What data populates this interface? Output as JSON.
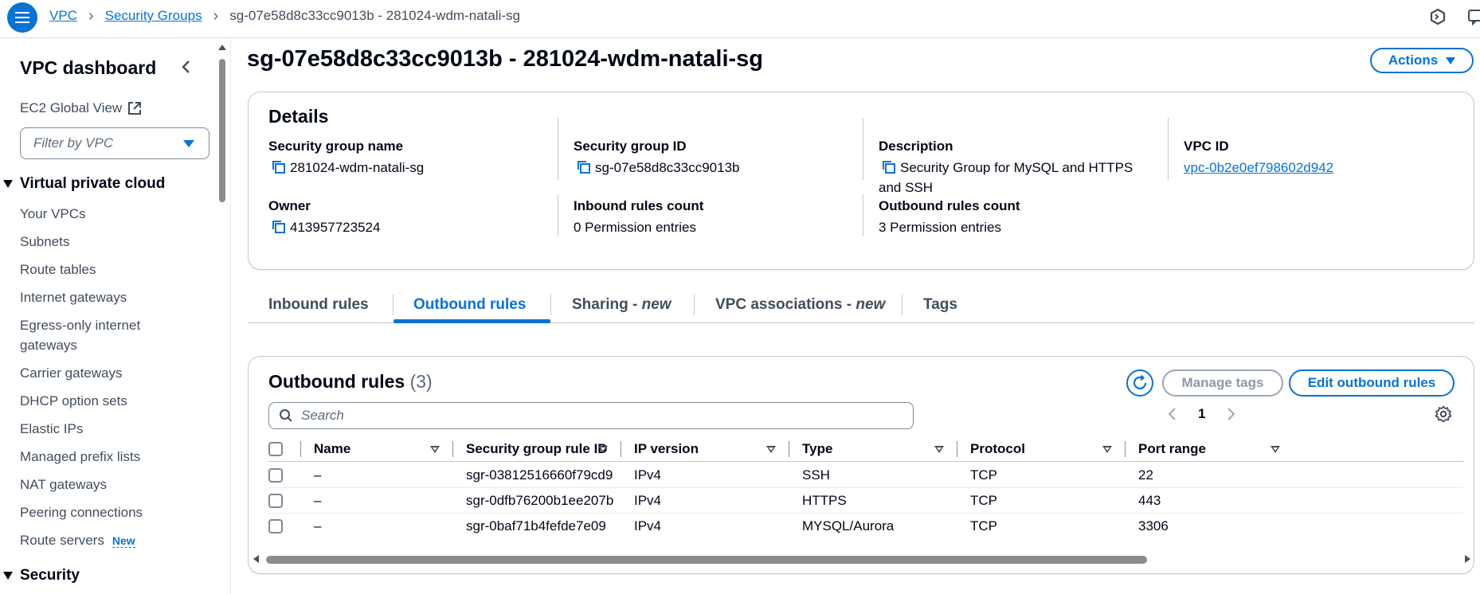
{
  "breadcrumb": {
    "items": [
      "VPC",
      "Security Groups"
    ],
    "current": "sg-07e58d8c33cc9013b - 281024-wdm-natali-sg"
  },
  "sidebar": {
    "title": "VPC dashboard",
    "global_view": "EC2 Global View",
    "filter_placeholder": "Filter by VPC",
    "section_vpc": "Virtual private cloud",
    "items": [
      "Your VPCs",
      "Subnets",
      "Route tables",
      "Internet gateways",
      "Egress-only internet gateways",
      "Carrier gateways",
      "DHCP option sets",
      "Elastic IPs",
      "Managed prefix lists",
      "NAT gateways",
      "Peering connections",
      "Route servers"
    ],
    "route_servers_badge": "New",
    "section_security": "Security"
  },
  "page": {
    "title": "sg-07e58d8c33cc9013b - 281024-wdm-natali-sg",
    "actions_label": "Actions"
  },
  "details": {
    "heading": "Details",
    "sg_name_label": "Security group name",
    "sg_name_value": "281024-wdm-natali-sg",
    "sg_id_label": "Security group ID",
    "sg_id_value": "sg-07e58d8c33cc9013b",
    "description_label": "Description",
    "description_value": "Security Group for MySQL and HTTPS and SSH",
    "vpc_id_label": "VPC ID",
    "vpc_id_value": "vpc-0b2e0ef798602d942",
    "owner_label": "Owner",
    "owner_value": "413957723524",
    "inbound_count_label": "Inbound rules count",
    "inbound_count_value": "0 Permission entries",
    "outbound_count_label": "Outbound rules count",
    "outbound_count_value": "3 Permission entries"
  },
  "tabs": {
    "inbound": "Inbound rules",
    "outbound": "Outbound rules",
    "sharing": "Sharing - ",
    "sharing_new": "new",
    "vpc_assoc": "VPC associations - ",
    "vpc_assoc_new": "new",
    "tags": "Tags"
  },
  "rules": {
    "heading": "Outbound rules",
    "count": "(3)",
    "manage_tags_label": "Manage tags",
    "edit_label": "Edit outbound rules",
    "search_placeholder": "Search",
    "page_number": "1",
    "columns": {
      "name": "Name",
      "rule_id": "Security group rule ID",
      "ip_version": "IP version",
      "type": "Type",
      "protocol": "Protocol",
      "port_range": "Port range"
    },
    "rows": [
      {
        "name": "–",
        "rule_id": "sgr-03812516660f79cd9",
        "ip_version": "IPv4",
        "type": "SSH",
        "protocol": "TCP",
        "port_range": "22"
      },
      {
        "name": "–",
        "rule_id": "sgr-0dfb76200b1ee207b",
        "ip_version": "IPv4",
        "type": "HTTPS",
        "protocol": "TCP",
        "port_range": "443"
      },
      {
        "name": "–",
        "rule_id": "sgr-0baf71b4fefde7e09",
        "ip_version": "IPv4",
        "type": "MYSQL/Aurora",
        "protocol": "TCP",
        "port_range": "3306"
      }
    ]
  },
  "colors": {
    "accent": "#0972d3",
    "text": "#000716",
    "muted": "#5f6b7a",
    "border": "#c6c6cd"
  },
  "icons": [
    "menu-icon",
    "chevron-right-icon",
    "cloudshell-icon",
    "feedback-icon",
    "chevron-left-icon",
    "external-link-icon",
    "caret-down-icon",
    "copy-icon",
    "refresh-icon",
    "search-icon",
    "settings-icon",
    "sort-icon"
  ]
}
